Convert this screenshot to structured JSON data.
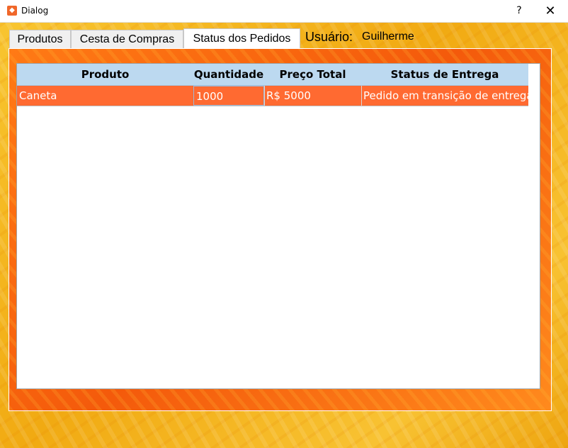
{
  "window": {
    "title": "Dialog",
    "help_label": "?",
    "close_label": "✕"
  },
  "tabs": [
    {
      "label": "Produtos",
      "active": false
    },
    {
      "label": "Cesta de Compras",
      "active": false
    },
    {
      "label": "Status dos Pedidos",
      "active": true
    }
  ],
  "user": {
    "label": "Usuário:",
    "name": "Guilherme"
  },
  "table": {
    "columns": [
      "Produto",
      "Quantidade",
      "Preço Total",
      "Status de Entrega"
    ],
    "rows": [
      [
        "Caneta",
        "1000",
        "R$ 5000",
        "Pedido em transição de entrega"
      ]
    ]
  },
  "colors": {
    "accent_orange": "#ff6a31",
    "header_blue": "#bcd9f0",
    "background_yellow": "#f2b41a"
  }
}
